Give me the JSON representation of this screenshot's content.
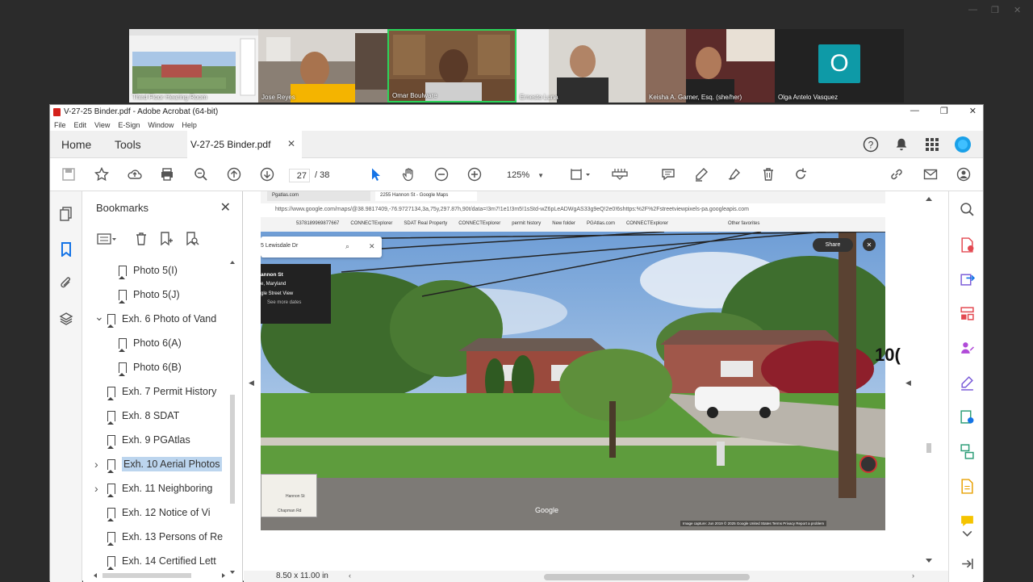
{
  "meeting": {
    "participants": [
      {
        "name": "Third Floor Hearing Room"
      },
      {
        "name": "Jose Reyes"
      },
      {
        "name": "Omar Boulware"
      },
      {
        "name": "Ernesto Luna"
      },
      {
        "name": "Keisha A. Garner, Esq. (she/her)"
      },
      {
        "name": "Olga Antelo Vasquez",
        "initial": "O"
      }
    ]
  },
  "window": {
    "title": "V-27-25 Binder.pdf - Adobe Acrobat (64-bit)",
    "menu": [
      "File",
      "Edit",
      "View",
      "E-Sign",
      "Window",
      "Help"
    ]
  },
  "tabs": {
    "home": "Home",
    "tools": "Tools",
    "document": "V-27-25 Binder.pdf"
  },
  "toolbar": {
    "page_current": "27",
    "page_total": "/ 38",
    "zoom": "125%"
  },
  "bookmarks": {
    "title": "Bookmarks",
    "items": [
      {
        "label": "Photo 5(I)",
        "level": 1,
        "expander": ""
      },
      {
        "label": "Photo 5(J)",
        "level": 1,
        "expander": ""
      },
      {
        "label": "Exh. 6 Photo of Vand",
        "level": 0,
        "expander": "expanded"
      },
      {
        "label": "Photo 6(A)",
        "level": 1,
        "expander": ""
      },
      {
        "label": "Photo 6(B)",
        "level": 1,
        "expander": ""
      },
      {
        "label": "Exh. 7 Permit History",
        "level": 0,
        "expander": ""
      },
      {
        "label": "Exh. 8 SDAT",
        "level": 0,
        "expander": ""
      },
      {
        "label": "Exh. 9 PGAtlas",
        "level": 0,
        "expander": ""
      },
      {
        "label": "Exh. 10 Aerial Photos",
        "level": 0,
        "expander": "collapsed",
        "selected": true
      },
      {
        "label": "Exh. 11 Neighboring",
        "level": 0,
        "expander": "collapsed"
      },
      {
        "label": "Exh. 12 Notice of Vi",
        "level": 0,
        "expander": ""
      },
      {
        "label": "Exh. 13 Persons of Re",
        "level": 0,
        "expander": ""
      },
      {
        "label": "Exh. 14 Certified Lett",
        "level": 0,
        "expander": ""
      }
    ]
  },
  "document": {
    "page_label": "10(",
    "page_size": "8.50 x 11.00 in",
    "embedded_browser": {
      "tabs": [
        "Pgatlas.com",
        "2255 Hannon St - Google Maps"
      ],
      "address": "https://www.google.com/maps/@38.9817409,-76.9727134,3a,75y,297.87h,90t/data=!3m7!1e1!3m5!1sStd-wZ6pLeADWgAS33g9eQ!2e0!6shttps:%2F%2Fstreetviewpixels-pa.googleapis.com",
      "favorites": [
        "Other favorites",
        "CONNECTExplorer",
        "PGAtlas.com",
        "New folder",
        "permit history",
        "CONNECTExplorer",
        "SDAT Real Property",
        "CONNECTExplorer",
        "5378189969877667"
      ],
      "search_text": "5 Lewisdale Dr",
      "place_card": {
        "title": "annon St",
        "subtitle": "e, Maryland",
        "kind": "gle Street View",
        "link": "See more dates"
      },
      "share": "Share",
      "google": "Google",
      "capture": "Image capture: Jun 2019 © 2025 Google United States Terms Privacy Report a problem",
      "minimap_labels": [
        "Hannon St",
        "Chapman Rd"
      ]
    }
  },
  "colors": {
    "accent": "#1473e6",
    "selected": "#bcd5ee",
    "avatar": "#0e9aa7",
    "active_speaker": "#2bd45a"
  }
}
